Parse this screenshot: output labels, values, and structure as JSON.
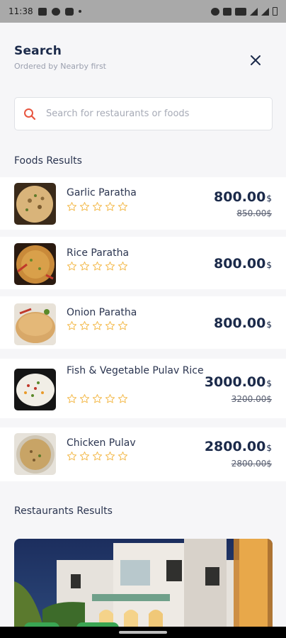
{
  "status_bar": {
    "time": "11:38"
  },
  "header": {
    "title": "Search",
    "subtitle": "Ordered by Nearby first"
  },
  "search": {
    "placeholder": "Search for restaurants or foods",
    "value": ""
  },
  "sections": {
    "foods": "Foods Results",
    "restaurants": "Restaurants Results"
  },
  "foods": [
    {
      "name": "Garlic Paratha",
      "price": "800.00",
      "currency": "$",
      "old_price": "850.00$",
      "rating": 0
    },
    {
      "name": "Rice Paratha",
      "price": "800.00",
      "currency": "$",
      "old_price": "",
      "rating": 0
    },
    {
      "name": "Onion Paratha",
      "price": "800.00",
      "currency": "$",
      "old_price": "",
      "rating": 0
    },
    {
      "name": "Fish & Vegetable Pulav Rice",
      "price": "3000.00",
      "currency": "$",
      "old_price": "3200.00$",
      "rating": 0
    },
    {
      "name": "Chicken Pulav",
      "price": "2800.00",
      "currency": "$",
      "old_price": "2800.00$",
      "rating": 0
    }
  ],
  "colors": {
    "accent": "#e8553f",
    "star": "#f3b94a",
    "text": "#1b2a4a"
  }
}
